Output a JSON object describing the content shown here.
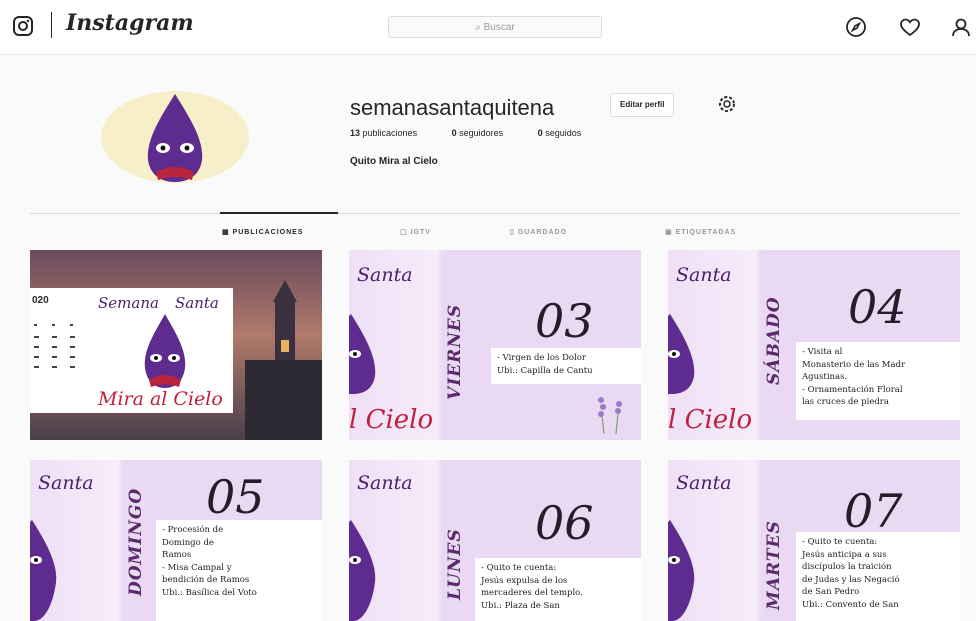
{
  "topbar": {
    "brand": "Instagram",
    "search_placeholder": "Buscar",
    "icons": [
      "instagram-glyph-icon",
      "compass-icon",
      "heart-icon",
      "profile-icon"
    ]
  },
  "profile": {
    "username": "semanasantaquitena",
    "edit_label": "Editar perfil",
    "posts_count": "13",
    "posts_label": "publicaciones",
    "followers_count": "0",
    "followers_label": "seguidores",
    "following_count": "0",
    "following_label": "seguidos",
    "full_name": "Quito Mira al Cielo"
  },
  "tabs": [
    {
      "label": "PUBLICACIONES"
    },
    {
      "label": "IGTV"
    },
    {
      "label": "GUARDADO"
    },
    {
      "label": "ETIQUETADAS"
    }
  ],
  "posts": [
    {
      "kind": "cover",
      "year": "020",
      "title_left": "Semana",
      "title_right": "Santa",
      "subtitle": "Mira al Cielo"
    },
    {
      "kind": "day",
      "script": "Santa",
      "cielo": "l Cielo",
      "day_word": "VIERNES",
      "number": "03",
      "text": "- Virgen de los Dolor\nUbi.: Capilla de Cantu"
    },
    {
      "kind": "day",
      "script": "Santa",
      "cielo": "l Cielo",
      "day_word": "SÁBADO",
      "number": "04",
      "text": "- Visita al\nMonasterio de las Madr\nAgustinas.\n- Ornamentación Floral\nlas cruces de piedra"
    },
    {
      "kind": "day",
      "script": "Santa",
      "cielo": "",
      "day_word": "DOMINGO",
      "number": "05",
      "text": "- Procesión de\nDomingo de\nRamos\n- Misa Campal y\nbendición de Ramos\nUbi.: Basílica del Voto"
    },
    {
      "kind": "day",
      "script": "Santa",
      "cielo": "",
      "day_word": "LUNES",
      "number": "06",
      "text": "- Quito te cuenta:\nJesús expulsa de los\nmercaderes del templo.\nUbi.: Plaza de San"
    },
    {
      "kind": "day",
      "script": "Santa",
      "cielo": "",
      "day_word": "MARTES",
      "number": "07",
      "text": "- Quito te cuenta:\nJesús anticipa a sus\ndiscípulos la traición\nde Judas y las Negació\nde San Pedro\nUbi.: Convento de San"
    }
  ],
  "colors": {
    "purple": "#5b2a86",
    "cucurucho": "#5e2b8f",
    "red_script": "#c0203f"
  }
}
